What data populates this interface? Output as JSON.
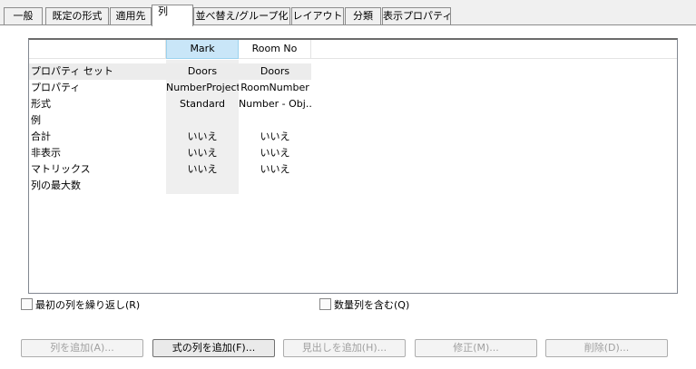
{
  "tabs": [
    {
      "label": "一般"
    },
    {
      "label": "既定の形式"
    },
    {
      "label": "適用先"
    },
    {
      "label": "列"
    },
    {
      "label": "並べ替え/グループ化"
    },
    {
      "label": "レイアウト"
    },
    {
      "label": "分類"
    },
    {
      "label": "表示プロパティ"
    }
  ],
  "grid": {
    "columns": [
      "Mark",
      "Room No"
    ],
    "rows": [
      {
        "label": "プロパティ セット",
        "values": [
          "Doors",
          "Doors"
        ]
      },
      {
        "label": "プロパティ",
        "values": [
          "NumberProject",
          "RoomNumber"
        ]
      },
      {
        "label": "形式",
        "values": [
          "Standard",
          "Number - Obj..."
        ]
      },
      {
        "label": "例",
        "values": [
          "",
          ""
        ]
      },
      {
        "label": "合計",
        "values": [
          "いいえ",
          "いいえ"
        ]
      },
      {
        "label": "非表示",
        "values": [
          "いいえ",
          "いいえ"
        ]
      },
      {
        "label": "マトリックス",
        "values": [
          "いいえ",
          "いいえ"
        ]
      },
      {
        "label": "列の最大数",
        "values": [
          "",
          ""
        ]
      }
    ]
  },
  "options": {
    "wrap_first_column": "最初の列を繰り返し(R)",
    "include_quantity_column": "数量列を含む(Q)"
  },
  "buttons": {
    "add_column": "列を追加(A)...",
    "add_formula_column": "式の列を追加(F)...",
    "add_header": "見出しを追加(H)...",
    "modify": "修正(M)...",
    "delete": "削除(D)..."
  }
}
